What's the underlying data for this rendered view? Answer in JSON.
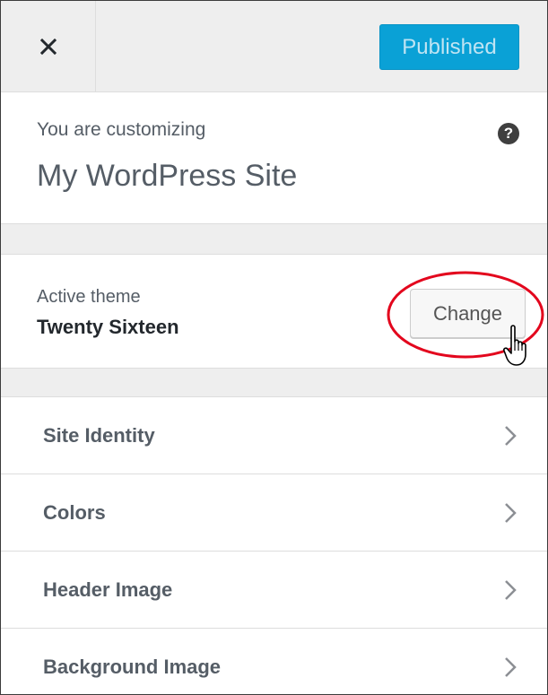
{
  "header": {
    "close_icon": "close-icon",
    "publish_label": "Published",
    "publish_color": "#0aa1d6"
  },
  "customizing": {
    "subtitle": "You are customizing",
    "site_name": "My WordPress Site",
    "help_icon": "help-icon",
    "help_glyph": "?"
  },
  "theme": {
    "label": "Active theme",
    "name": "Twenty Sixteen",
    "change_label": "Change",
    "highlight_color": "#e3061d"
  },
  "panels": [
    {
      "label": "Site Identity",
      "icon": "chevron-right-icon"
    },
    {
      "label": "Colors",
      "icon": "chevron-right-icon"
    },
    {
      "label": "Header Image",
      "icon": "chevron-right-icon"
    },
    {
      "label": "Background Image",
      "icon": "chevron-right-icon"
    }
  ]
}
